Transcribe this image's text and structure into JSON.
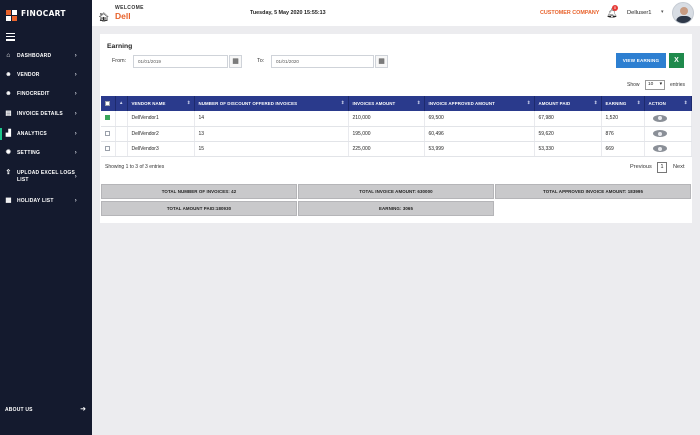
{
  "app": {
    "logo_text": "FINOCART"
  },
  "sidebar": {
    "items": [
      {
        "label": "DASHBOARD",
        "icon": "home-icon"
      },
      {
        "label": "VENDOR",
        "icon": "users-icon"
      },
      {
        "label": "FINOCREDIT",
        "icon": "users-icon"
      },
      {
        "label": "INVOICE DETAILS",
        "icon": "document-icon"
      },
      {
        "label": "ANALYTICS",
        "icon": "chart-icon"
      },
      {
        "label": "SETTING",
        "icon": "gear-icon"
      },
      {
        "label": "UPLOAD EXCEL LOGS LIST",
        "icon": "upload-icon"
      },
      {
        "label": "HOLIDAY LIST",
        "icon": "calendar-icon"
      }
    ],
    "about": "ABOUT US"
  },
  "header": {
    "welcome": "WELCOME",
    "user": "Dell",
    "datetime": "Tuesday, 5 May 2020 15:55:13",
    "company": "CUSTOMER COMPANY",
    "notif_count": "0",
    "username": "Delluser1"
  },
  "earning": {
    "title": "Earning",
    "from_label": "From:",
    "from_value": "01/01/2019",
    "to_label": "To:",
    "to_value": "01/01/2020",
    "view_button": "VIEW EARNING",
    "show_label": "Show",
    "show_value": "10",
    "entries_label": "entries",
    "columns": [
      "",
      "VENDOR NAME",
      "NUMBER OF DISCOUNT OFFERED INVOICES",
      "INVOICES AMOUNT",
      "INVOICE APPROVED AMOUNT",
      "AMOUNT PAID",
      "EARNING",
      "ACTION"
    ],
    "rows": [
      {
        "vendor": "DellVendor1",
        "count": "14",
        "invoice_amount": "210,000",
        "approved": "69,500",
        "paid": "67,980",
        "earning": "1,520",
        "checked": true
      },
      {
        "vendor": "DellVendor2",
        "count": "13",
        "invoice_amount": "195,000",
        "approved": "60,496",
        "paid": "59,620",
        "earning": "876",
        "checked": false
      },
      {
        "vendor": "DellVendor3",
        "count": "15",
        "invoice_amount": "225,000",
        "approved": "53,999",
        "paid": "53,330",
        "earning": "669",
        "checked": false
      }
    ],
    "info": "Showing 1 to 3 of 3 entries",
    "previous": "Previous",
    "page": "1",
    "next": "Next",
    "summary": {
      "total_invoices": "TOTAL NUMBER OF INVOICES: 42",
      "total_invoice_amount": "TOTAL INVOICE AMOUNT: 630000",
      "total_approved": "TOTAL APPROVED INVOICE AMOUNT: 183995",
      "total_paid": "TOTAL AMOUNT PAID:180930",
      "earning": "EARNING: 3065"
    }
  }
}
